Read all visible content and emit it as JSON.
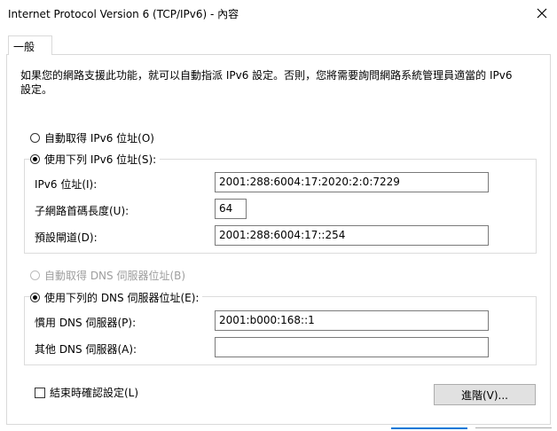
{
  "window": {
    "title": "Internet Protocol Version 6 (TCP/IPv6) - 內容"
  },
  "tabs": [
    {
      "label": "一般"
    }
  ],
  "description": {
    "line1": "如果您的網路支援此功能，就可以自動指派 IPv6 設定。否則，您將需要詢問網路系統管理員適當的 IPv6",
    "line2": "設定。"
  },
  "ip_section": {
    "auto_label": "自動取得 IPv6 位址(O)",
    "auto_checked": false,
    "manual_label": "使用下列 IPv6 位址(S):",
    "manual_checked": true,
    "fields": [
      {
        "label": "IPv6 位址(I):",
        "value": "2001:288:6004:17:2020:2:0:7229"
      },
      {
        "label": "子網路首碼長度(U):",
        "value": "64"
      },
      {
        "label": "預設閘道(D):",
        "value": "2001:288:6004:17::254"
      }
    ]
  },
  "dns_section": {
    "auto_label": "自動取得 DNS 伺服器位址(B)",
    "auto_checked": false,
    "auto_disabled": true,
    "manual_label": "使用下列的 DNS 伺服器位址(E):",
    "manual_checked": true,
    "fields": [
      {
        "label": "慣用 DNS 伺服器(P):",
        "value": "2001:b000:168::1"
      },
      {
        "label": "其他 DNS 伺服器(A):",
        "value": ""
      }
    ]
  },
  "validate_on_exit": {
    "label": "結束時確認設定(L)",
    "checked": false
  },
  "buttons": {
    "advanced": "進階(V)..."
  },
  "colors": {
    "accent": "#0078d7",
    "border": "#7a7a7a",
    "button_bg": "#e1e1e1",
    "disabled_text": "#9e9e9e"
  }
}
